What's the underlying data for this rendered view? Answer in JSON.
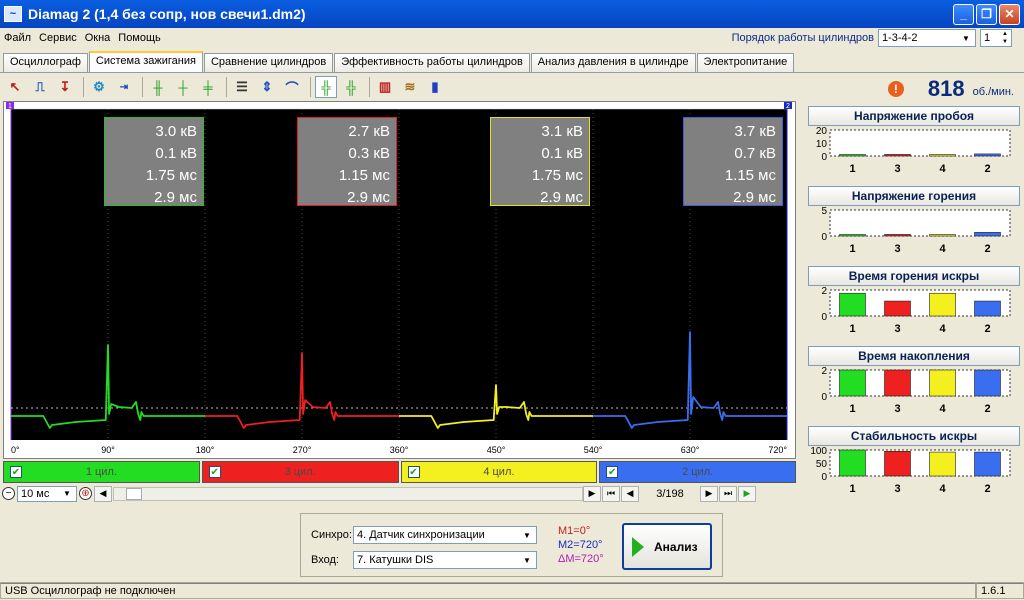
{
  "window": {
    "title": "Diamag 2 (1,4 без сопр, нов свечи1.dm2)",
    "icon": "diamag-app-icon"
  },
  "menu": [
    "Файл",
    "Сервис",
    "Окна",
    "Помощь"
  ],
  "firing_order": {
    "label": "Порядок работы цилиндров",
    "value": "1-3-4-2",
    "spin_value": "1"
  },
  "tabs": [
    "Осциллограф",
    "Система зажигания",
    "Сравнение цилиндров",
    "Эффективность работы цилиндров",
    "Анализ давления в цилиндре",
    "Электропитание"
  ],
  "active_tab": 1,
  "rpm": {
    "value": "818",
    "unit": "об./мин."
  },
  "scope": {
    "marker_left": "1",
    "marker_right": "2",
    "degree_ticks": [
      "0°",
      "90°",
      "180°",
      "270°",
      "360°",
      "450°",
      "540°",
      "630°",
      "720°"
    ],
    "measurements": [
      {
        "color": "#22c022",
        "voltage": "3.0 кВ",
        "burn_voltage": "0.1 кВ",
        "burn_time": "1.75 мс",
        "dwell": "2.9 мс"
      },
      {
        "color": "#e02020",
        "voltage": "2.7 кВ",
        "burn_voltage": "0.3 кВ",
        "burn_time": "1.15 мс",
        "dwell": "2.9 мс"
      },
      {
        "color": "#e8e020",
        "voltage": "3.1 кВ",
        "burn_voltage": "0.1 кВ",
        "burn_time": "1.75 мс",
        "dwell": "2.9 мс"
      },
      {
        "color": "#3a5ee8",
        "voltage": "3.7 кВ",
        "burn_voltage": "0.7 кВ",
        "burn_time": "1.15 мс",
        "dwell": "2.9 мс"
      }
    ]
  },
  "cylinders": [
    {
      "label": "1 цил.",
      "color": "#22dd22"
    },
    {
      "label": "3 цил.",
      "color": "#ee2020"
    },
    {
      "label": "4 цил.",
      "color": "#f4f020"
    },
    {
      "label": "2 цил.",
      "color": "#3a6ef0"
    }
  ],
  "scale": {
    "value": "10 мс",
    "page": "3/198"
  },
  "analysis": {
    "sync_label": "Синхро:",
    "sync_value": "4.  Датчик синхронизации",
    "input_label": "Вход:",
    "input_value": "7.  Катушки DIS",
    "m1": "M1=0°",
    "m2": "M2=720°",
    "dm": "ΔM=720°",
    "button": "Анализ"
  },
  "status": {
    "text": "USB Осциллограф не подключен",
    "version": "1.6.1"
  },
  "panels": [
    {
      "title": "Напряжение пробоя",
      "ticks": [
        "20",
        "10",
        "0"
      ],
      "ymax": 20,
      "values": [
        1.0,
        1.2,
        0.8,
        1.6
      ],
      "cats": [
        "1",
        "3",
        "4",
        "2"
      ]
    },
    {
      "title": "Напряжение горения",
      "ticks": [
        "5",
        "0"
      ],
      "ymax": 5,
      "values": [
        0.1,
        0.3,
        0.1,
        0.7
      ],
      "cats": [
        "1",
        "3",
        "4",
        "2"
      ]
    },
    {
      "title": "Время горения искры",
      "ticks": [
        "2",
        "0"
      ],
      "ymax": 2,
      "values": [
        1.75,
        1.15,
        1.75,
        1.15
      ],
      "cats": [
        "1",
        "3",
        "4",
        "2"
      ]
    },
    {
      "title": "Время накопления",
      "ticks": [
        "2",
        "0"
      ],
      "ymax": 2,
      "values": [
        2.9,
        2.9,
        2.9,
        2.9
      ],
      "cats": [
        "1",
        "3",
        "4",
        "2"
      ]
    },
    {
      "title": "Стабильность искры",
      "ticks": [
        "100",
        "50",
        "0"
      ],
      "ymax": 100,
      "values": [
        100,
        95,
        92,
        92
      ],
      "cats": [
        "1",
        "3",
        "4",
        "2"
      ]
    }
  ],
  "chart_data": {
    "type": "line",
    "xlabel": "",
    "ylabel": "",
    "xlim": [
      0,
      720
    ],
    "x_ticks": [
      "0°",
      "90°",
      "180°",
      "270°",
      "360°",
      "450°",
      "540°",
      "630°",
      "720°"
    ],
    "series": [
      {
        "name": "1 цил.",
        "color": "#22dd22",
        "spark_deg": 90
      },
      {
        "name": "3 цил.",
        "color": "#ee2020",
        "spark_deg": 270
      },
      {
        "name": "4 цил.",
        "color": "#f4f020",
        "spark_deg": 450
      },
      {
        "name": "2 цил.",
        "color": "#3a6ef0",
        "spark_deg": 630
      }
    ]
  }
}
